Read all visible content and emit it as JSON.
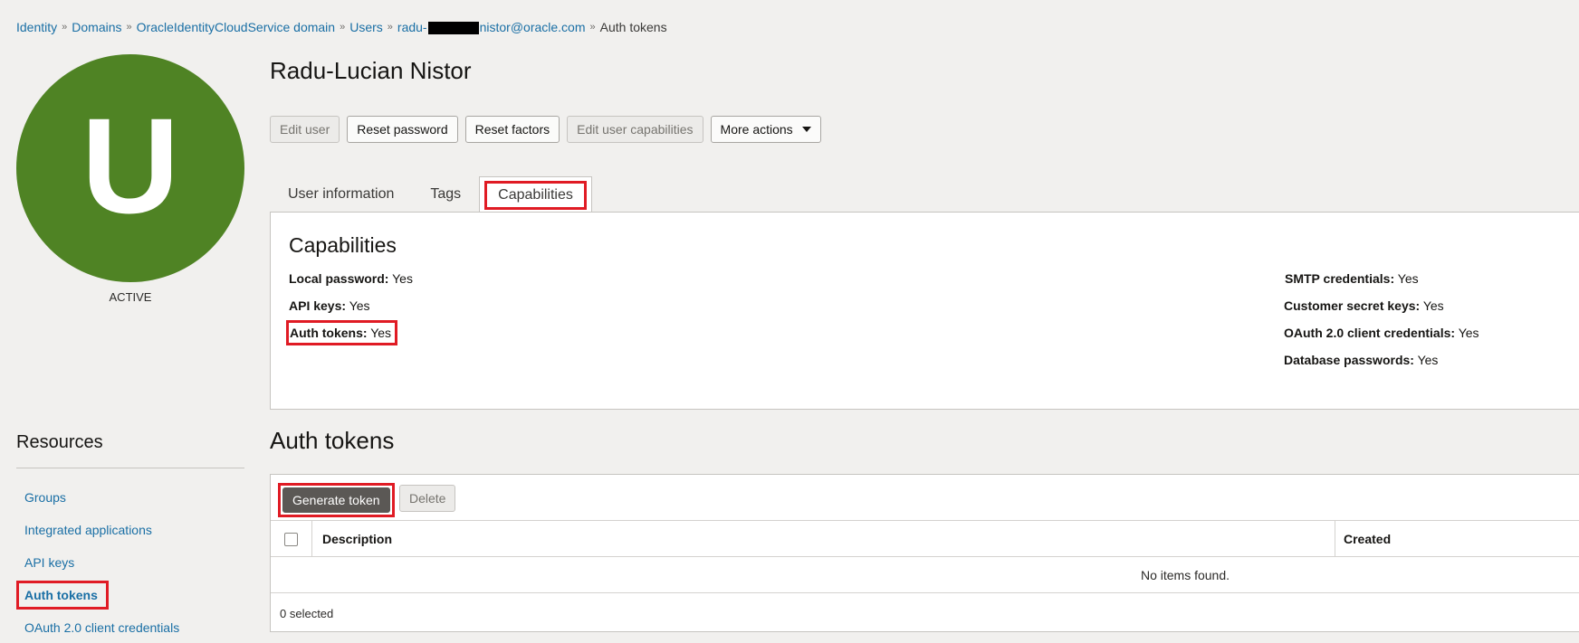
{
  "breadcrumb": {
    "items": [
      "Identity",
      "Domains",
      "OracleIdentityCloudService domain",
      "Users"
    ],
    "user_prefix": "radu-",
    "user_suffix": "nistor@oracle.com",
    "current": "Auth tokens"
  },
  "user": {
    "avatar_letter": "U",
    "avatar_color": "#4f8324",
    "status": "ACTIVE",
    "name": "Radu-Lucian Nistor"
  },
  "actions": {
    "edit_user": "Edit user",
    "reset_password": "Reset password",
    "reset_factors": "Reset factors",
    "edit_capabilities": "Edit user capabilities",
    "more_actions": "More actions"
  },
  "tabs": {
    "user_information": "User information",
    "tags": "Tags",
    "capabilities": "Capabilities"
  },
  "capabilities": {
    "title": "Capabilities",
    "left": [
      {
        "label": "Local password:",
        "value": "Yes"
      },
      {
        "label": "API keys:",
        "value": "Yes"
      },
      {
        "label": "Auth tokens:",
        "value": "Yes"
      }
    ],
    "right": [
      {
        "label": "SMTP credentials:",
        "value": "Yes"
      },
      {
        "label": "Customer secret keys:",
        "value": "Yes"
      },
      {
        "label": "OAuth 2.0 client credentials:",
        "value": "Yes"
      },
      {
        "label": "Database passwords:",
        "value": "Yes"
      }
    ]
  },
  "resources": {
    "title": "Resources",
    "items": [
      "Groups",
      "Integrated applications",
      "API keys",
      "Auth tokens",
      "OAuth 2.0 client credentials"
    ]
  },
  "auth_tokens": {
    "title": "Auth tokens",
    "generate_label": "Generate token",
    "delete_label": "Delete",
    "columns": [
      "Description",
      "Created"
    ],
    "empty_message": "No items found.",
    "selected_count": "0 selected"
  },
  "colors": {
    "highlight": "#e01b24",
    "link": "#1a6fa5"
  }
}
